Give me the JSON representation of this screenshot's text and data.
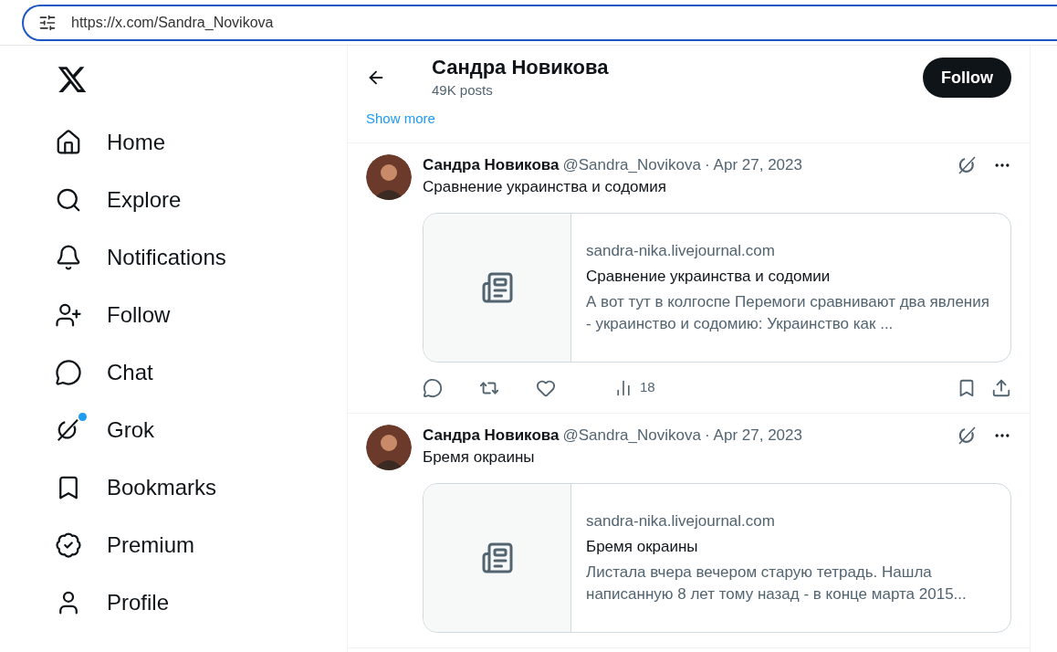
{
  "browser": {
    "url": "https://x.com/Sandra_Novikova"
  },
  "sidebar": {
    "items": [
      {
        "label": "Home",
        "has_dot": false
      },
      {
        "label": "Explore",
        "has_dot": false
      },
      {
        "label": "Notifications",
        "has_dot": false
      },
      {
        "label": "Follow",
        "has_dot": false
      },
      {
        "label": "Chat",
        "has_dot": false
      },
      {
        "label": "Grok",
        "has_dot": true
      },
      {
        "label": "Bookmarks",
        "has_dot": false
      },
      {
        "label": "Premium",
        "has_dot": false
      },
      {
        "label": "Profile",
        "has_dot": false
      }
    ]
  },
  "header": {
    "name": "Сандра Новикова",
    "posts": "49K posts",
    "follow_button": "Follow"
  },
  "show_more": "Show more",
  "posts": [
    {
      "name": "Сандра Новикова",
      "handle": "@Sandra_Novikova",
      "separator": "·",
      "date": "Apr 27, 2023",
      "text": "Сравнение украинства и содомия",
      "card": {
        "domain": "sandra-nika.livejournal.com",
        "title": "Сравнение украинства и содомии",
        "description": "А вот тут в колгоспе Перемоги сравнивают два явления - украинство и содомию: Украинство как ..."
      },
      "views": "18"
    },
    {
      "name": "Сандра Новикова",
      "handle": "@Sandra_Novikova",
      "separator": "·",
      "date": "Apr 27, 2023",
      "text": "Бремя окраины",
      "card": {
        "domain": "sandra-nika.livejournal.com",
        "title": "Бремя окраины",
        "description": "Листала вчера вечером старую тетрадь. Нашла написанную 8 лет тому назад - в конце марта 2015..."
      }
    }
  ]
}
